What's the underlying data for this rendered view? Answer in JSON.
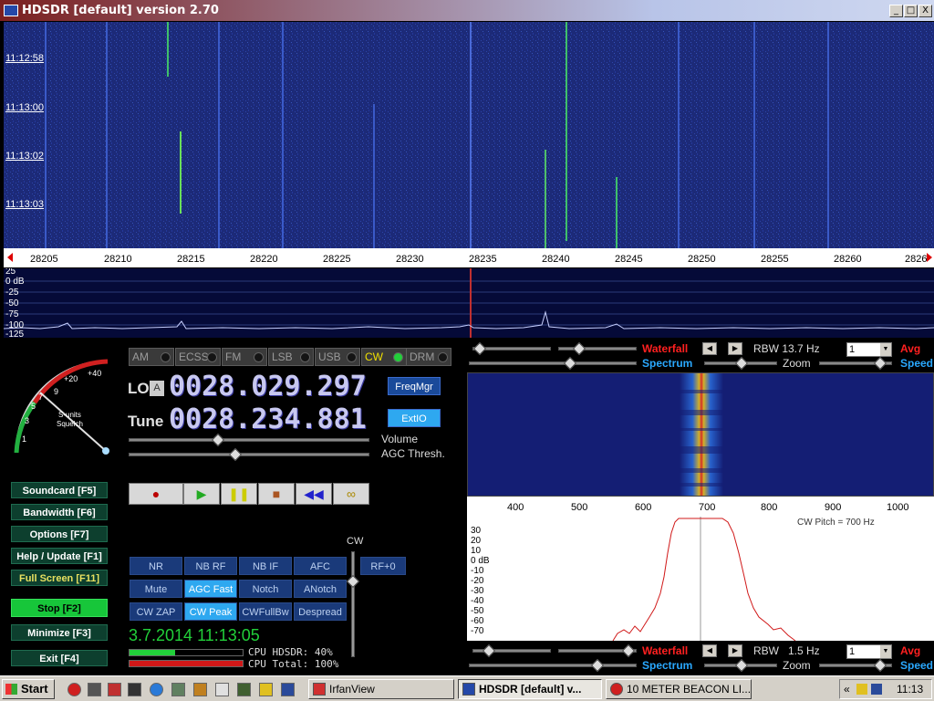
{
  "window": {
    "title": "HDSDR [default]  version 2.70",
    "minimize_glyph": "_",
    "maximize_glyph": "□",
    "close_glyph": "X"
  },
  "waterfall": {
    "timestamps": [
      "11:12:58",
      "11:13:00",
      "11:13:02",
      "11:13:03"
    ]
  },
  "freq_scale": {
    "ticks": [
      "28205",
      "28210",
      "28215",
      "28220",
      "28225",
      "28230",
      "28235",
      "28240",
      "28245",
      "28250",
      "28255",
      "28260",
      "2826"
    ]
  },
  "spectrum": {
    "db_labels": [
      "25",
      "0 dB",
      "-25",
      "-50",
      "-75",
      "-100",
      "-125"
    ]
  },
  "smeter": {
    "scale": [
      "1",
      "3",
      "5",
      "7",
      "9",
      "+20",
      "+40"
    ],
    "label_line1": "S-units",
    "label_line2": "Squelch"
  },
  "sidebar_buttons": [
    {
      "label": "Soundcard  [F5]"
    },
    {
      "label": "Bandwidth  [F6]"
    },
    {
      "label": "Options   [F7]"
    },
    {
      "label": "Help / Update  [F1]"
    },
    {
      "label": "Full Screen  [F11]"
    },
    {
      "label": "Stop       [F2]"
    },
    {
      "label": "Minimize  [F3]"
    },
    {
      "label": "Exit      [F4]"
    }
  ],
  "modes": [
    {
      "label": "AM"
    },
    {
      "label": "ECSS"
    },
    {
      "label": "FM"
    },
    {
      "label": "LSB"
    },
    {
      "label": "USB"
    },
    {
      "label": "CW"
    },
    {
      "label": "DRM"
    }
  ],
  "lo": {
    "label": "LO",
    "lock": "A",
    "value": "0028.029.297"
  },
  "tune": {
    "label": "Tune",
    "value": "0028.234.881"
  },
  "freq_buttons": {
    "freqmgr": "FreqMgr",
    "extio": "ExtIO"
  },
  "sliders": {
    "volume": "Volume",
    "agc": "AGC Thresh."
  },
  "transport": {
    "record": "●",
    "play": "▶",
    "pause": "❚❚",
    "stop": "■",
    "rewind": "◀◀",
    "loop": "∞"
  },
  "cw_label": "CW",
  "dsp_buttons": [
    {
      "label": "NR"
    },
    {
      "label": "NB RF"
    },
    {
      "label": "NB IF"
    },
    {
      "label": "AFC"
    },
    {
      "label": "Mute"
    },
    {
      "label": "AGC Fast"
    },
    {
      "label": "Notch"
    },
    {
      "label": "ANotch"
    },
    {
      "label": "CW ZAP"
    },
    {
      "label": "CW Peak"
    },
    {
      "label": "CWFullBw"
    },
    {
      "label": "Despread"
    }
  ],
  "rf_button": "RF+0",
  "datetime": "3.7.2014 11:13:05",
  "cpu": {
    "hdsdr_label": "CPU HDSDR:  40%",
    "hdsdr_percent": 40,
    "total_label": "CPU Total: 100%",
    "total_percent": 100
  },
  "top_panel": {
    "waterfall": "Waterfall",
    "spectrum": "Spectrum",
    "zoom": "Zoom",
    "rbw": "RBW 13.7 Hz",
    "avg_value": "1",
    "avg": "Avg",
    "speed": "Speed"
  },
  "bottom_panel": {
    "waterfall": "Waterfall",
    "spectrum": "Spectrum",
    "zoom": "Zoom",
    "rbw": "RBW   1.5 Hz",
    "avg_value": "1",
    "avg": "Avg",
    "speed": "Speed"
  },
  "zoom_scale": {
    "ticks": [
      "400",
      "500",
      "600",
      "700",
      "800",
      "900",
      "1000"
    ]
  },
  "zoom_spec": {
    "pitch": "CW Pitch = 700 Hz",
    "db_labels": [
      "30",
      "20",
      "10",
      "0 dB",
      "-10",
      "-20",
      "-30",
      "-40",
      "-50",
      "-60",
      "-70"
    ]
  },
  "taskbar": {
    "start": "Start",
    "tasks": [
      {
        "label": "IrfanView"
      },
      {
        "label": "HDSDR [default]  v..."
      },
      {
        "label": "10 METER BEACON LI..."
      }
    ],
    "tray_expand": "«",
    "clock": "11:13"
  }
}
